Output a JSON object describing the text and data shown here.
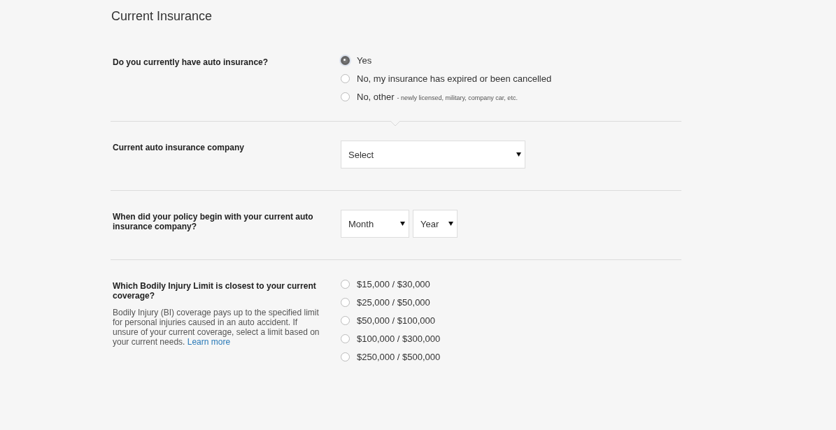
{
  "title": "Current Insurance",
  "sections": [
    {
      "kind": "radio",
      "question": "Do you currently have auto insurance?",
      "options": [
        {
          "label": "Yes",
          "selected": true
        },
        {
          "label": "No, my insurance has expired or been cancelled",
          "selected": false
        },
        {
          "label": "No, other",
          "note": "- newly licensed, military, company car, etc.",
          "selected": false
        }
      ]
    },
    {
      "kind": "select",
      "question": "Current auto insurance company",
      "selects": [
        {
          "value": "Select"
        }
      ]
    },
    {
      "kind": "select",
      "question": "When did your policy begin with your current auto insurance company?",
      "selects": [
        {
          "value": "Month"
        },
        {
          "value": "Year"
        }
      ]
    },
    {
      "kind": "radio",
      "question": "Which Bodily Injury Limit is closest to your current coverage?",
      "description": "Bodily Injury (BI) coverage pays up to the specified limit for personal injuries caused in an auto accident. If unsure of your current coverage, select a limit based on your current needs.",
      "link": "Learn more",
      "options": [
        {
          "label": "$15,000 / $30,000",
          "selected": false
        },
        {
          "label": "$25,000 / $50,000",
          "selected": false
        },
        {
          "label": "$50,000 / $100,000",
          "selected": false
        },
        {
          "label": "$100,000 / $300,000",
          "selected": false
        },
        {
          "label": "$250,000 / $500,000",
          "selected": false
        }
      ]
    }
  ]
}
